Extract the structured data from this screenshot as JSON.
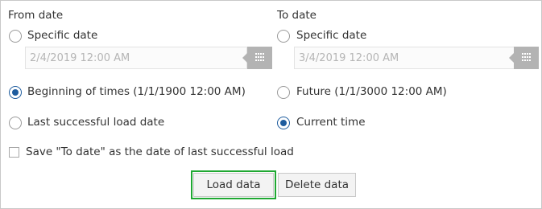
{
  "from": {
    "title": "From date",
    "specific_label": "Specific date",
    "date_value": "2/4/2019 12:00 AM",
    "options": [
      {
        "label": "Beginning of times (1/1/1900 12:00 AM)",
        "checked": true
      },
      {
        "label": "Last successful load date",
        "checked": false
      }
    ]
  },
  "to": {
    "title": "To date",
    "specific_label": "Specific date",
    "date_value": "3/4/2019 12:00 AM",
    "options": [
      {
        "label": "Future (1/1/3000 12:00 AM)",
        "checked": false
      },
      {
        "label": "Current time",
        "checked": true
      }
    ]
  },
  "save_checkbox": {
    "label": "Save \"To date\" as the date of last successful load",
    "checked": false
  },
  "buttons": {
    "load": "Load data",
    "delete": "Delete data"
  },
  "colors": {
    "radio_checked": "#1e5c9e",
    "highlight_outline": "#1fa832",
    "calendar_button": "#b3b3b3"
  },
  "icons": {
    "calendar": "calendar-grid-icon"
  }
}
